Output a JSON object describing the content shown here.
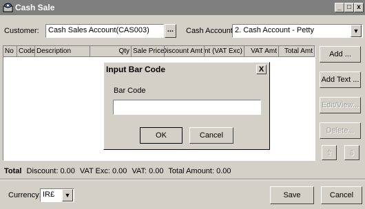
{
  "window": {
    "title": "Cash Sale",
    "controls": {
      "minimize": "_",
      "maximize": "□",
      "close": "x"
    }
  },
  "customer": {
    "label": "Customer:",
    "value": "Cash Sales Account(CAS003)",
    "lookup": "..."
  },
  "cash_account": {
    "label": "Cash Account:",
    "value": "2. Cash Account - Petty"
  },
  "table": {
    "columns": [
      "No",
      "Code",
      "Description",
      "Qty",
      "Sale Price",
      "Discount Amt",
      "Amt (VAT Exc)",
      "VAT Amt",
      "Total Amt"
    ],
    "rows": []
  },
  "side_buttons": {
    "add": "Add ...",
    "add_text": "Add Text ...",
    "edit_view": "Edit/View...",
    "delete": "Delete..."
  },
  "totals": {
    "label": "Total",
    "discount": "Discount: 0.00",
    "vat_exc": "VAT Exc: 0.00",
    "vat": "VAT: 0.00",
    "total_amount": "Total Amount: 0.00"
  },
  "currency": {
    "label": "Currency:",
    "value": "IR£"
  },
  "footer": {
    "save": "Save",
    "cancel": "Cancel"
  },
  "dialog": {
    "title": "Input Bar Code",
    "close": "X",
    "field_label": "Bar Code",
    "field_value": "",
    "ok": "OK",
    "cancel": "Cancel"
  }
}
